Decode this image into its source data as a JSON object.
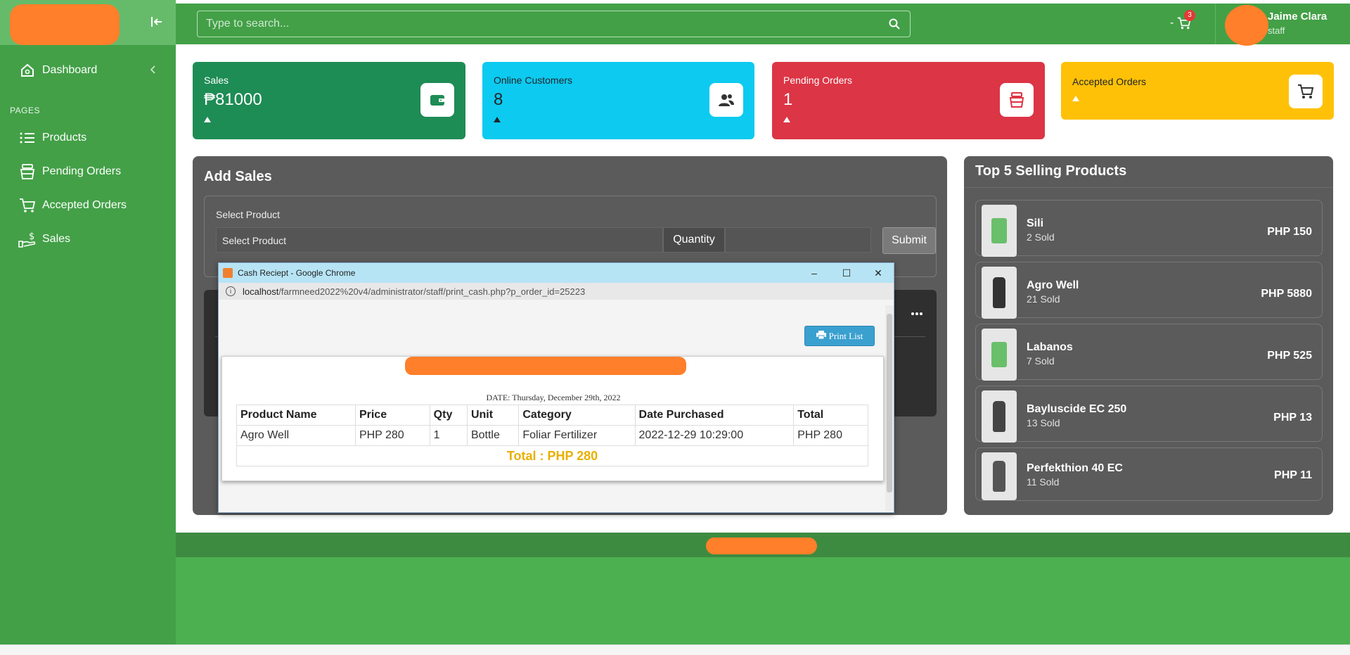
{
  "topbar": {
    "search_placeholder": "Type to search...",
    "cart_prefix": "-",
    "cart_count": "3",
    "user_name": "Jaime Clara",
    "user_role": "staff"
  },
  "sidebar": {
    "dashboard": "Dashboard",
    "section_label": "PAGES",
    "items": [
      {
        "label": "Products",
        "icon": "list-icon"
      },
      {
        "label": "Pending Orders",
        "icon": "box-icon"
      },
      {
        "label": "Accepted Orders",
        "icon": "cart-icon"
      },
      {
        "label": "Sales",
        "icon": "money-hand-icon"
      }
    ]
  },
  "cards": [
    {
      "title": "Sales",
      "value": "₱81000",
      "color": "#1e8c55",
      "icon": "wallet-icon"
    },
    {
      "title": "Online Customers",
      "value": "8",
      "color": "#0dcaf0",
      "icon": "users-icon"
    },
    {
      "title": "Pending Orders",
      "value": "1",
      "color": "#dc3545",
      "icon": "box-icon"
    },
    {
      "title": "Accepted Orders",
      "value": "",
      "color": "#ffc107",
      "icon": "cart-icon"
    }
  ],
  "add_sales": {
    "title": "Add Sales",
    "select_label": "Select Product",
    "select_placeholder": "Select Product",
    "quantity_label": "Quantity",
    "submit": "Submit"
  },
  "top_selling": {
    "title": "Top 5 Selling Products",
    "items": [
      {
        "name": "Sili",
        "sold": "2 Sold",
        "price": "PHP 150"
      },
      {
        "name": "Agro Well",
        "sold": "21 Sold",
        "price": "PHP 5880"
      },
      {
        "name": "Labanos",
        "sold": "7 Sold",
        "price": "PHP 525"
      },
      {
        "name": "Bayluscide EC 250",
        "sold": "13 Sold",
        "price": "PHP 13"
      },
      {
        "name": "Perfekthion 40 EC",
        "sold": "11 Sold",
        "price": "PHP 11"
      }
    ]
  },
  "popup": {
    "title": "Cash Reciept - Google Chrome",
    "url_host": "localhost",
    "url_path": "/farmneed2022%20v4/administrator/staff/print_cash.php?p_order_id=25223",
    "print_button": "Print List",
    "date_line": "DATE: Thursday, December 29th, 2022",
    "headers": [
      "Product Name",
      "Price",
      "Qty",
      "Unit",
      "Category",
      "Date Purchased",
      "Total"
    ],
    "rows": [
      [
        "Agro Well",
        "PHP 280",
        "1",
        "Bottle",
        "Foliar Fertilizer",
        "2022-12-29 10:29:00",
        "PHP 280"
      ]
    ],
    "total": "Total : PHP 280"
  }
}
